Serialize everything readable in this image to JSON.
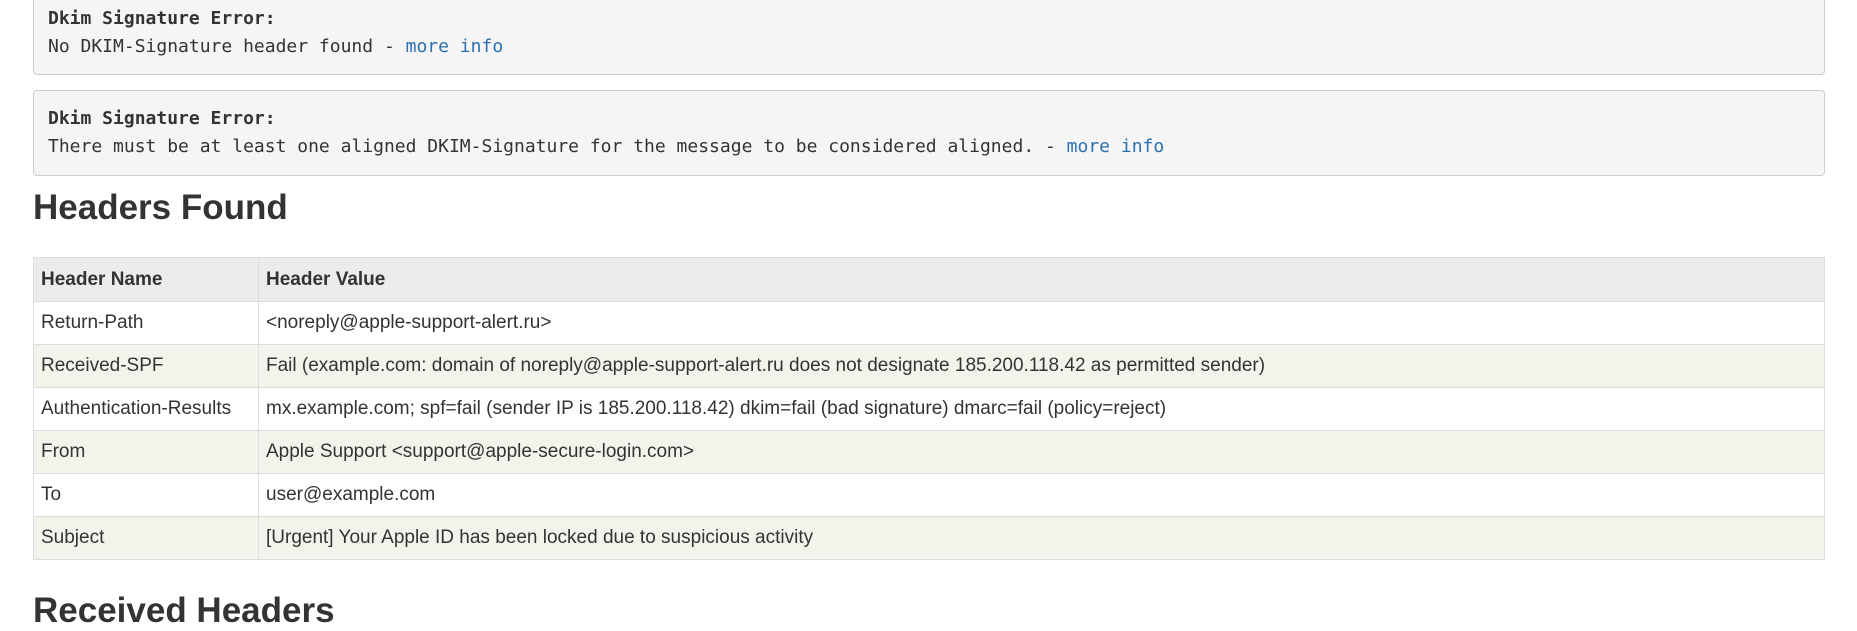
{
  "errors": [
    {
      "title": "Dkim Signature Error:",
      "message": "No DKIM-Signature header found - ",
      "link": "more info"
    },
    {
      "title": "Dkim Signature Error:",
      "message": "There must be at least one aligned DKIM-Signature for the message to be considered aligned. - ",
      "link": "more info"
    }
  ],
  "headers_found": {
    "heading": "Headers Found",
    "columns": [
      "Header Name",
      "Header Value"
    ],
    "rows": [
      {
        "name": "Return-Path",
        "value": "<noreply@apple-support-alert.ru>"
      },
      {
        "name": "Received-SPF",
        "value": "Fail (example.com: domain of noreply@apple-support-alert.ru does not designate 185.200.118.42 as permitted sender)"
      },
      {
        "name": "Authentication-Results",
        "value": "mx.example.com; spf=fail (sender IP is 185.200.118.42) dkim=fail (bad signature) dmarc=fail (policy=reject)"
      },
      {
        "name": "From",
        "value": "Apple Support <support@apple-secure-login.com>"
      },
      {
        "name": "To",
        "value": "user@example.com"
      },
      {
        "name": "Subject",
        "value": "[Urgent] Your Apple ID has been locked due to suspicious activity"
      }
    ]
  },
  "next_section": {
    "heading": "Received Headers"
  }
}
